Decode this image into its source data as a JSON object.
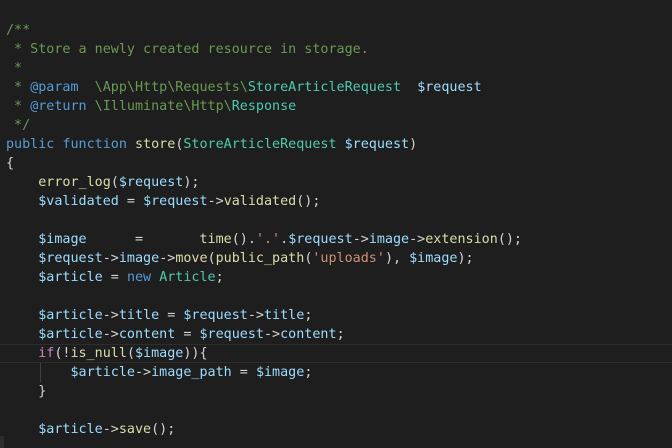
{
  "editor": {
    "language": "php",
    "theme_colors": {
      "background": "#1e1e1e",
      "comment": "#6a9955",
      "keyword": "#569cd6",
      "control": "#c586c0",
      "function": "#dcdcaa",
      "type": "#4ec9b0",
      "variable": "#9cdcfe",
      "string": "#ce9178",
      "text": "#d4d4d4"
    },
    "lines": [
      {
        "tokens": [
          {
            "t": "comment",
            "v": "/**"
          }
        ]
      },
      {
        "tokens": [
          {
            "t": "comment",
            "v": " * Store a newly created resource in storage."
          }
        ]
      },
      {
        "tokens": [
          {
            "t": "comment",
            "v": " *"
          }
        ]
      },
      {
        "tokens": [
          {
            "t": "comment",
            "v": " * "
          },
          {
            "t": "keyword",
            "v": "@param"
          },
          {
            "t": "comment",
            "v": "  \\App\\Http\\Requests\\"
          },
          {
            "t": "type",
            "v": "StoreArticleRequest"
          },
          {
            "t": "comment",
            "v": "  "
          },
          {
            "t": "variable",
            "v": "$request"
          }
        ]
      },
      {
        "tokens": [
          {
            "t": "comment",
            "v": " * "
          },
          {
            "t": "keyword",
            "v": "@return"
          },
          {
            "t": "comment",
            "v": " \\Illuminate\\Http\\"
          },
          {
            "t": "type",
            "v": "Response"
          }
        ]
      },
      {
        "tokens": [
          {
            "t": "comment",
            "v": " */"
          }
        ]
      },
      {
        "tokens": [
          {
            "t": "keyword",
            "v": "public"
          },
          {
            "t": "plain",
            "v": " "
          },
          {
            "t": "keyword",
            "v": "function"
          },
          {
            "t": "plain",
            "v": " "
          },
          {
            "t": "function",
            "v": "store"
          },
          {
            "t": "plain",
            "v": "("
          },
          {
            "t": "type",
            "v": "StoreArticleRequest"
          },
          {
            "t": "plain",
            "v": " "
          },
          {
            "t": "variable",
            "v": "$request"
          },
          {
            "t": "plain",
            "v": ")"
          }
        ]
      },
      {
        "tokens": [
          {
            "t": "plain",
            "v": "{"
          }
        ]
      },
      {
        "tokens": [
          {
            "t": "plain",
            "v": "    "
          },
          {
            "t": "function",
            "v": "error_log"
          },
          {
            "t": "plain",
            "v": "("
          },
          {
            "t": "variable",
            "v": "$request"
          },
          {
            "t": "plain",
            "v": ");"
          }
        ]
      },
      {
        "tokens": [
          {
            "t": "plain",
            "v": "    "
          },
          {
            "t": "variable",
            "v": "$validated"
          },
          {
            "t": "plain",
            "v": " = "
          },
          {
            "t": "variable",
            "v": "$request"
          },
          {
            "t": "plain",
            "v": "->"
          },
          {
            "t": "function",
            "v": "validated"
          },
          {
            "t": "plain",
            "v": "();"
          }
        ]
      },
      {
        "tokens": []
      },
      {
        "tokens": [
          {
            "t": "plain",
            "v": "    "
          },
          {
            "t": "variable",
            "v": "$image"
          },
          {
            "t": "plain",
            "v": "      =       "
          },
          {
            "t": "function",
            "v": "time"
          },
          {
            "t": "plain",
            "v": "()."
          },
          {
            "t": "string",
            "v": "'.'"
          },
          {
            "t": "plain",
            "v": "."
          },
          {
            "t": "variable",
            "v": "$request"
          },
          {
            "t": "plain",
            "v": "->"
          },
          {
            "t": "variable",
            "v": "image"
          },
          {
            "t": "plain",
            "v": "->"
          },
          {
            "t": "function",
            "v": "extension"
          },
          {
            "t": "plain",
            "v": "();"
          }
        ]
      },
      {
        "tokens": [
          {
            "t": "plain",
            "v": "    "
          },
          {
            "t": "variable",
            "v": "$request"
          },
          {
            "t": "plain",
            "v": "->"
          },
          {
            "t": "variable",
            "v": "image"
          },
          {
            "t": "plain",
            "v": "->"
          },
          {
            "t": "function",
            "v": "move"
          },
          {
            "t": "plain",
            "v": "("
          },
          {
            "t": "function",
            "v": "public_path"
          },
          {
            "t": "plain",
            "v": "("
          },
          {
            "t": "string",
            "v": "'uploads'"
          },
          {
            "t": "plain",
            "v": "), "
          },
          {
            "t": "variable",
            "v": "$image"
          },
          {
            "t": "plain",
            "v": ");"
          }
        ]
      },
      {
        "tokens": [
          {
            "t": "plain",
            "v": "    "
          },
          {
            "t": "variable",
            "v": "$article"
          },
          {
            "t": "plain",
            "v": " = "
          },
          {
            "t": "keyword",
            "v": "new"
          },
          {
            "t": "plain",
            "v": " "
          },
          {
            "t": "type",
            "v": "Article"
          },
          {
            "t": "plain",
            "v": ";"
          }
        ]
      },
      {
        "tokens": []
      },
      {
        "tokens": [
          {
            "t": "plain",
            "v": "    "
          },
          {
            "t": "variable",
            "v": "$article"
          },
          {
            "t": "plain",
            "v": "->"
          },
          {
            "t": "variable",
            "v": "title"
          },
          {
            "t": "plain",
            "v": " = "
          },
          {
            "t": "variable",
            "v": "$request"
          },
          {
            "t": "plain",
            "v": "->"
          },
          {
            "t": "variable",
            "v": "title"
          },
          {
            "t": "plain",
            "v": ";"
          }
        ]
      },
      {
        "tokens": [
          {
            "t": "plain",
            "v": "    "
          },
          {
            "t": "variable",
            "v": "$article"
          },
          {
            "t": "plain",
            "v": "->"
          },
          {
            "t": "variable",
            "v": "content"
          },
          {
            "t": "plain",
            "v": " = "
          },
          {
            "t": "variable",
            "v": "$request"
          },
          {
            "t": "plain",
            "v": "->"
          },
          {
            "t": "variable",
            "v": "content"
          },
          {
            "t": "plain",
            "v": ";"
          }
        ]
      },
      {
        "tokens": [
          {
            "t": "plain",
            "v": "    "
          },
          {
            "t": "control",
            "v": "if"
          },
          {
            "t": "plain",
            "v": "(!"
          },
          {
            "t": "function",
            "v": "is_null"
          },
          {
            "t": "plain",
            "v": "("
          },
          {
            "t": "variable",
            "v": "$image"
          },
          {
            "t": "plain",
            "v": ")){"
          }
        ]
      },
      {
        "tokens": [
          {
            "t": "plain",
            "v": "        "
          },
          {
            "t": "variable",
            "v": "$article"
          },
          {
            "t": "plain",
            "v": "->"
          },
          {
            "t": "variable",
            "v": "image_path"
          },
          {
            "t": "plain",
            "v": " = "
          },
          {
            "t": "variable",
            "v": "$image"
          },
          {
            "t": "plain",
            "v": ";"
          }
        ]
      },
      {
        "tokens": [
          {
            "t": "plain",
            "v": "    }"
          }
        ]
      },
      {
        "tokens": []
      },
      {
        "tokens": [
          {
            "t": "plain",
            "v": "    "
          },
          {
            "t": "variable",
            "v": "$article"
          },
          {
            "t": "plain",
            "v": "->"
          },
          {
            "t": "function",
            "v": "save"
          },
          {
            "t": "plain",
            "v": "();"
          }
        ]
      }
    ]
  }
}
